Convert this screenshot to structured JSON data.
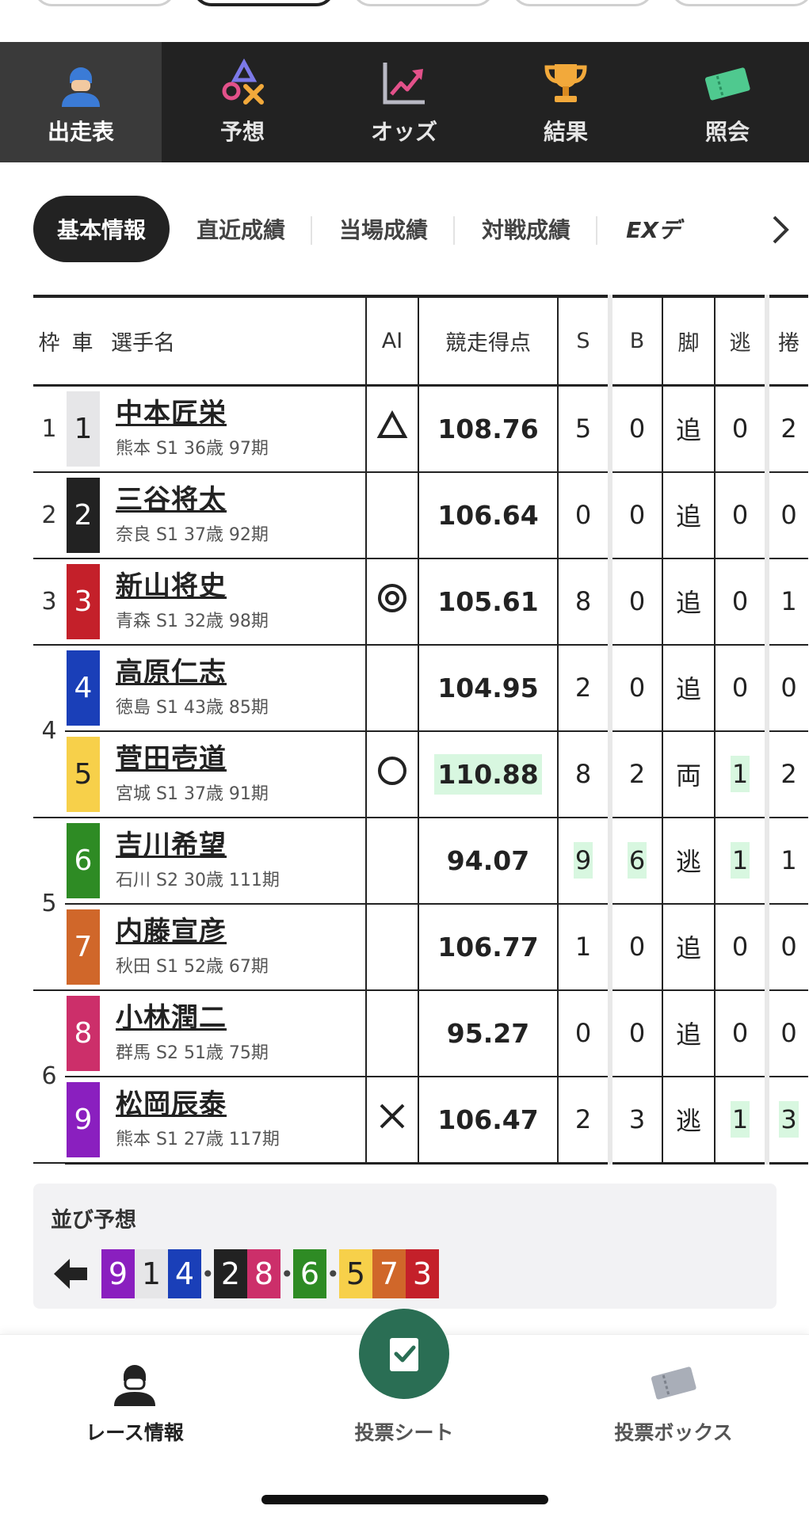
{
  "main_nav": [
    {
      "key": "shussohyo",
      "label": "出走表",
      "icon": "rider-icon",
      "active": true
    },
    {
      "key": "yoso",
      "label": "予想",
      "icon": "prediction-shapes-icon",
      "active": false
    },
    {
      "key": "odds",
      "label": "オッズ",
      "icon": "chart-trend-icon",
      "active": false
    },
    {
      "key": "kekka",
      "label": "結果",
      "icon": "trophy-icon",
      "active": false
    },
    {
      "key": "shokai",
      "label": "照会",
      "icon": "ticket-icon",
      "active": false
    }
  ],
  "sub_tabs": [
    {
      "label": "基本情報",
      "active": true
    },
    {
      "label": "直近成績",
      "active": false
    },
    {
      "label": "当場成績",
      "active": false
    },
    {
      "label": "対戦成績",
      "active": false
    },
    {
      "label": "EXデ",
      "active": false
    }
  ],
  "table": {
    "headers": {
      "frame": "枠",
      "car": "車",
      "name": "選手名",
      "ai": "AI",
      "score": "競走得点",
      "s": "S",
      "b": "B",
      "kyaku": "脚",
      "nige": "逃",
      "makuri": "捲"
    },
    "frames": [
      {
        "frame": "1",
        "rows": 1
      },
      {
        "frame": "2",
        "rows": 1
      },
      {
        "frame": "3",
        "rows": 1
      },
      {
        "frame": "4",
        "rows": 2
      },
      {
        "frame": "5",
        "rows": 2
      },
      {
        "frame": "6",
        "rows": 2
      }
    ],
    "rows": [
      {
        "car": "1",
        "car_color": "#e6e6e8",
        "car_text": "#222222",
        "name": "中本匠栄",
        "info": "熊本 S1 36歳 97期",
        "ai": "triangle",
        "score": "108.76",
        "s": "5",
        "b": "0",
        "kyaku": "追",
        "nige": "0",
        "makuri": "2"
      },
      {
        "car": "2",
        "car_color": "#222222",
        "car_text": "#ffffff",
        "name": "三谷将太",
        "info": "奈良 S1 37歳 92期",
        "ai": "",
        "score": "106.64",
        "s": "0",
        "b": "0",
        "kyaku": "追",
        "nige": "0",
        "makuri": "0"
      },
      {
        "car": "3",
        "car_color": "#c4202a",
        "car_text": "#ffffff",
        "name": "新山将史",
        "info": "青森 S1 32歳 98期",
        "ai": "double-circle",
        "score": "105.61",
        "s": "8",
        "b": "0",
        "kyaku": "追",
        "nige": "0",
        "makuri": "1"
      },
      {
        "car": "4",
        "car_color": "#1a3fb8",
        "car_text": "#ffffff",
        "name": "高原仁志",
        "info": "徳島 S1 43歳 85期",
        "ai": "",
        "score": "104.95",
        "s": "2",
        "b": "0",
        "kyaku": "追",
        "nige": "0",
        "makuri": "0"
      },
      {
        "car": "5",
        "car_color": "#f7d04a",
        "car_text": "#222222",
        "name": "菅田壱道",
        "info": "宮城 S1 37歳 91期",
        "ai": "circle",
        "score": "110.88",
        "s": "8",
        "b": "2",
        "kyaku": "両",
        "nige": "1",
        "makuri": "2"
      },
      {
        "car": "6",
        "car_color": "#2e8b24",
        "car_text": "#ffffff",
        "name": "吉川希望",
        "info": "石川 S2 30歳 111期",
        "ai": "",
        "score": "94.07",
        "s": "9",
        "b": "6",
        "kyaku": "逃",
        "nige": "1",
        "makuri": "1"
      },
      {
        "car": "7",
        "car_color": "#d0672a",
        "car_text": "#ffffff",
        "name": "内藤宣彦",
        "info": "秋田 S1 52歳 67期",
        "ai": "",
        "score": "106.77",
        "s": "1",
        "b": "0",
        "kyaku": "追",
        "nige": "0",
        "makuri": "0"
      },
      {
        "car": "8",
        "car_color": "#cc2f6a",
        "car_text": "#ffffff",
        "name": "小林潤二",
        "info": "群馬 S2 51歳 75期",
        "ai": "",
        "score": "95.27",
        "s": "0",
        "b": "0",
        "kyaku": "追",
        "nige": "0",
        "makuri": "0"
      },
      {
        "car": "9",
        "car_color": "#8a1fbf",
        "car_text": "#ffffff",
        "name": "松岡辰泰",
        "info": "熊本 S1 27歳 117期",
        "ai": "cross",
        "score": "106.47",
        "s": "2",
        "b": "3",
        "kyaku": "逃",
        "nige": "1",
        "makuri": "3"
      }
    ],
    "highlights": {
      "score": [
        "110.88"
      ],
      "cells": [
        [
          4,
          "nige"
        ],
        [
          5,
          "s"
        ],
        [
          5,
          "b"
        ],
        [
          5,
          "nige"
        ],
        [
          8,
          "nige"
        ],
        [
          8,
          "makuri"
        ]
      ]
    }
  },
  "prediction": {
    "title": "並び予想",
    "line": [
      "9",
      "1",
      "4",
      "•",
      "2",
      "8",
      "•",
      "6",
      "•",
      "5",
      "7",
      "3"
    ]
  },
  "bottom_bar": {
    "race_info": "レース情報",
    "bet_sheet": "投票シート",
    "bet_box": "投票ボックス"
  },
  "colors": {
    "nav_bg": "#222222",
    "highlight": "#d8f7e0",
    "fab": "#2a6e54"
  }
}
